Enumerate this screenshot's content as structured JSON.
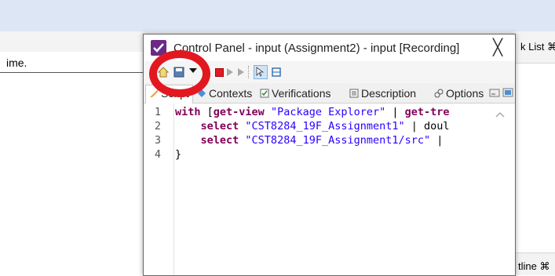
{
  "background": {
    "left_text": "ime.",
    "right_top_label": "k List ⌘",
    "right_bottom_label": "tline ⌘"
  },
  "dialog": {
    "title": "Control Panel - input (Assignment2) - input [Recording]",
    "close_symbol": "╳"
  },
  "tabs": [
    {
      "label": "Script",
      "icon": "script-icon"
    },
    {
      "label": "Contexts",
      "icon": "contexts-icon"
    },
    {
      "label": "Verifications",
      "icon": "verifications-icon"
    },
    {
      "label": "Description",
      "icon": "description-icon"
    },
    {
      "label": "Options",
      "icon": "options-icon"
    }
  ],
  "editor": {
    "line_numbers": [
      "1",
      "2",
      "3",
      "4"
    ],
    "lines": [
      {
        "kw": "with",
        "rest1": " [",
        "kw2": "get-view",
        "str": " \"Package Explorer\"",
        "rest2": " | ",
        "kw3": "get-tre"
      },
      {
        "indent": "    ",
        "kw": "select",
        "str": " \"CST8284_19F_Assignment1\"",
        "rest": " | doul"
      },
      {
        "indent": "    ",
        "kw": "select",
        "str": " \"CST8284_19F_Assignment1/src\"",
        "rest": " |"
      },
      {
        "text": "}"
      }
    ]
  },
  "colors": {
    "annotation_circle": "#e3171f",
    "keyword": "#7f0055",
    "string": "#2a00ff",
    "accent": "#6b2a86"
  }
}
